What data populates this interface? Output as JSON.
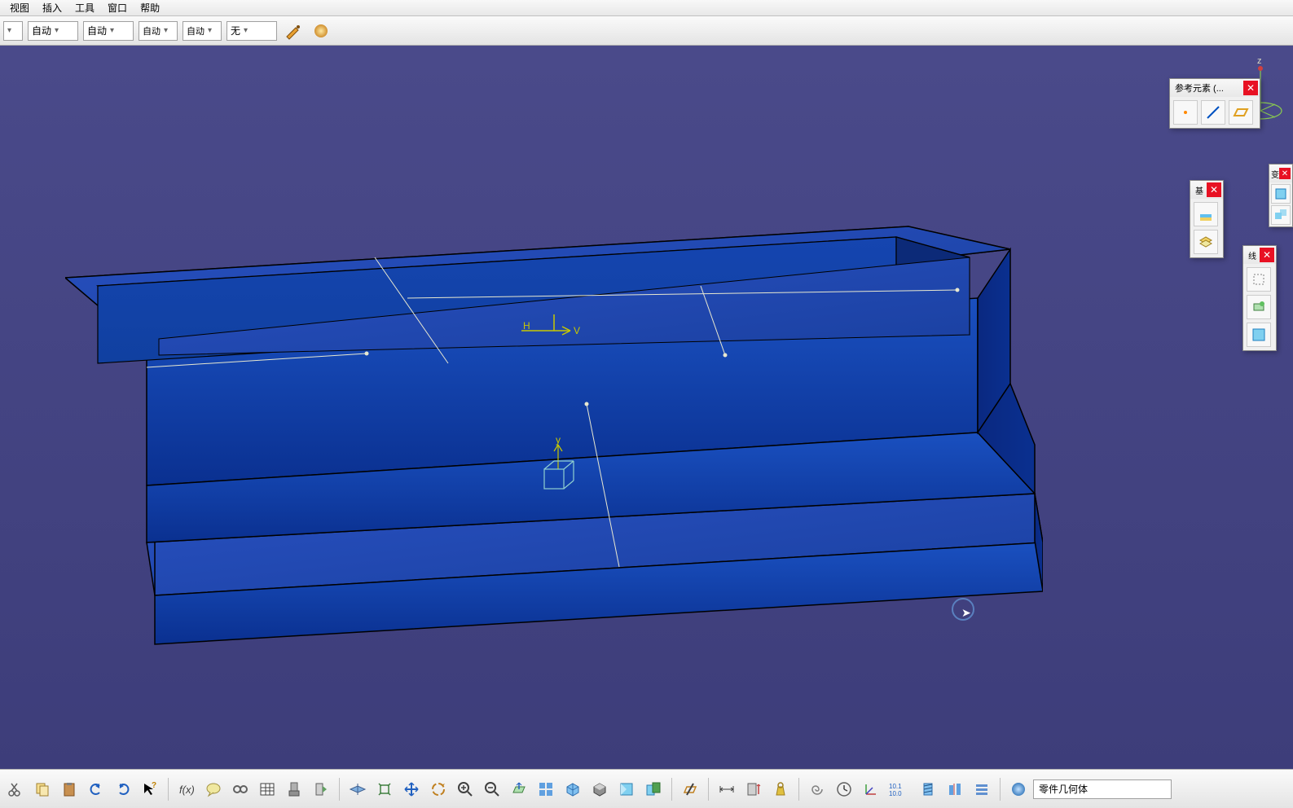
{
  "menu": {
    "view": "视图",
    "insert": "插入",
    "tools": "工具",
    "window": "窗口",
    "help": "帮助"
  },
  "toolbar": {
    "auto1": "自动",
    "auto2": "自动",
    "autos1": "自动",
    "autos2": "自动",
    "none": "无"
  },
  "ref_panel": {
    "title": "参考元素  (..."
  },
  "panel2": {
    "title": "基"
  },
  "panel3": {
    "title": "线"
  },
  "panel4": {
    "title": "变"
  },
  "axis": {
    "h": "H",
    "v": "V",
    "y": "y"
  },
  "status": {
    "body": "零件几何体"
  }
}
